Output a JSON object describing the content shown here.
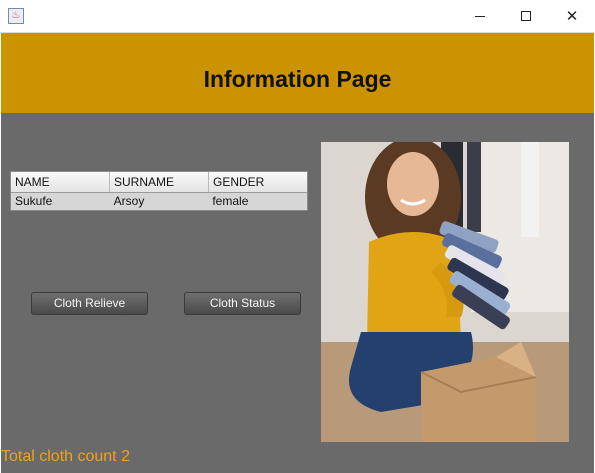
{
  "window": {
    "icon": "java-cup-icon",
    "controls": {
      "minimize": "minimize-icon",
      "maximize": "maximize-icon",
      "close": "close-icon",
      "close_glyph": "✕"
    }
  },
  "header": {
    "title": "Information Page",
    "background": "#cc9300"
  },
  "table": {
    "columns": [
      "NAME",
      "SURNAME",
      "GENDER"
    ],
    "rows": [
      [
        "Sukufe",
        "Arsoy",
        "female"
      ]
    ]
  },
  "buttons": {
    "relieve": "Cloth Relieve",
    "status": "Cloth Status"
  },
  "footer": {
    "count_text": "Total cloth count 2",
    "count_color": "#f0a020"
  },
  "colors": {
    "panel": "#6a6a6a",
    "accent": "#cc9300"
  }
}
